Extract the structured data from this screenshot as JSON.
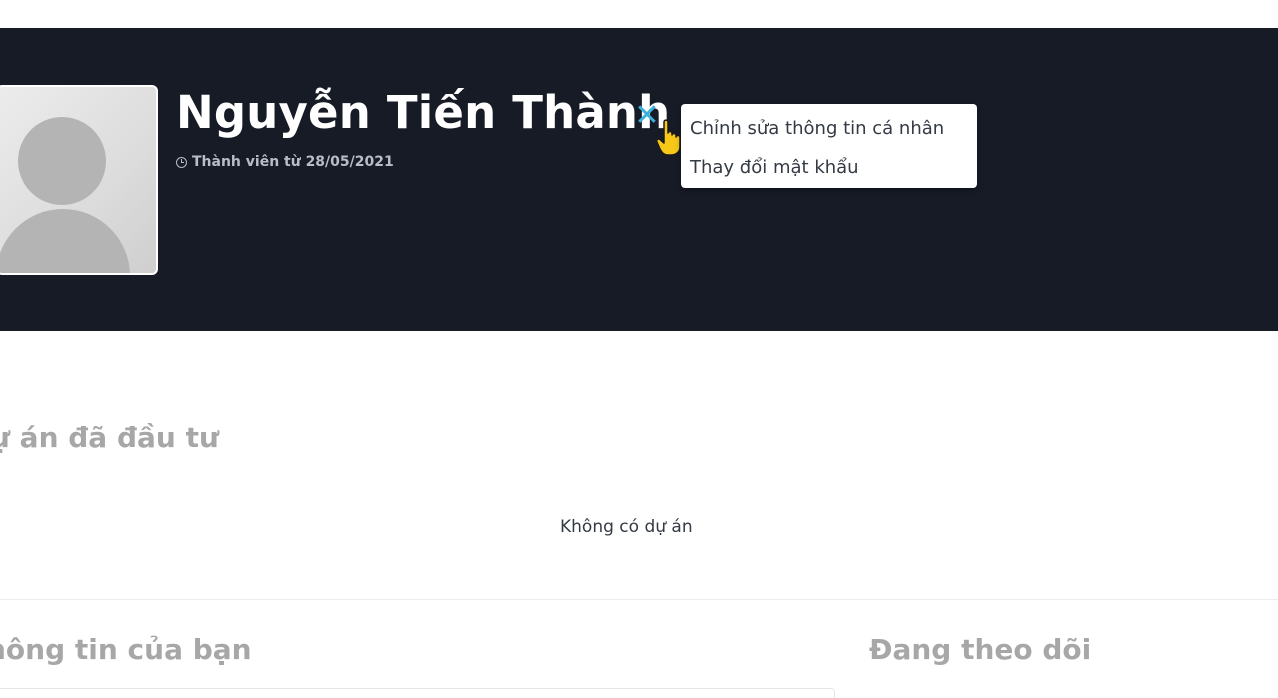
{
  "profile": {
    "name": "Nguyễn Tiến Thành",
    "member_since": "Thành viên từ 28/05/2021",
    "close_icon": "✕"
  },
  "dropdown": {
    "items": [
      {
        "label": "Chỉnh sửa thông tin cá nhân"
      },
      {
        "label": "Thay đổi mật khẩu"
      }
    ]
  },
  "sections": {
    "invested_title": "ự án đã đầu tư",
    "empty_projects": "Không có dự án",
    "your_info_title": "hông tin của bạn",
    "following_title": "Đang theo dõi"
  },
  "colors": {
    "banner": "#161b26",
    "accent": "#3cb0dc",
    "section_title": "#a7a7a7"
  }
}
